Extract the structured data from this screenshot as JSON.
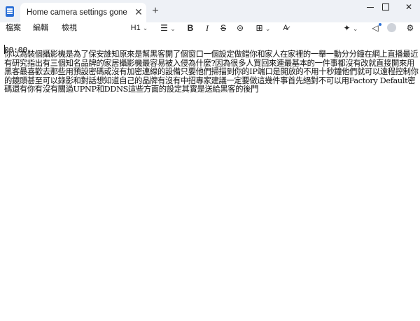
{
  "window": {
    "tab_title": "Home camera settings gone wrong",
    "close_tab": "✕",
    "new_tab": "+",
    "close": "✕"
  },
  "menu": {
    "file": "檔案",
    "edit": "編輯",
    "view": "檢視"
  },
  "toolbar": {
    "heading": "H1",
    "chevron": "⌄",
    "bold": "B",
    "italic": "I",
    "strike": "S",
    "link": "⊝",
    "table": "⊞",
    "clear_format": "A̷",
    "copilot": "✦",
    "announce": "📢",
    "settings": "⚙",
    "list": "☰"
  },
  "icons": {
    "app": "notepad-icon",
    "accent": "#2b6fd6"
  },
  "document": {
    "timestamp": "00:00",
    "body": "你以為裝個攝影機是為了保安誰知原來是幫黑客開了個窗口一個設定做錯你和家人在家裡的一舉一動分分鐘在網上直播最近有研究指出有三個知名品牌的家居攝影機最容易被入侵為什麼?因為很多人買回來連最基本的一件事都沒有改就直接開來用 黑客最喜歡去那些用預設密碼或沒有加密連線的設備只要他們掃描到你的IP端口是開放的不用十秒鐘他們就可以遠程控制你的鏡頭甚至可以錄影和對話想知道自己的品牌有沒有中招專家建議一定要做這幾件事首先絕對不可以用Factory Default密碼還有你有沒有關過UPNP和DDNS這些方面的設定其實是送給黑客的後門"
  }
}
